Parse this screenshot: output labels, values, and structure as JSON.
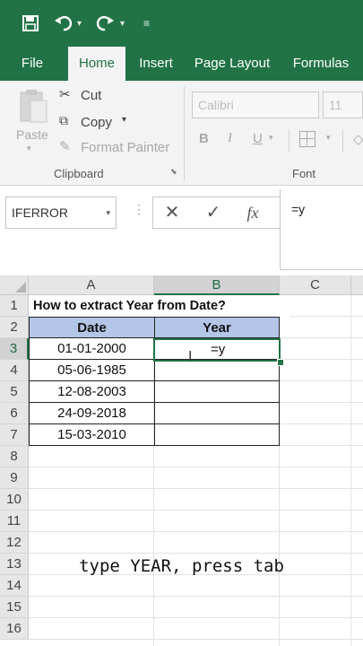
{
  "qat": {
    "save_icon": "save-icon",
    "undo_icon": "undo-icon",
    "redo_icon": "redo-icon",
    "customize_icon": "customize-qat-icon"
  },
  "tabs": [
    {
      "label": "File"
    },
    {
      "label": "Home"
    },
    {
      "label": "Insert"
    },
    {
      "label": "Page Layout"
    },
    {
      "label": "Formulas"
    }
  ],
  "ribbon": {
    "paste_label": "Paste",
    "cut_label": "Cut",
    "copy_label": "Copy",
    "format_painter_label": "Format Painter",
    "clipboard_group": "Clipboard",
    "font_name": "Calibri",
    "font_size": "11",
    "bold": "B",
    "italic": "I",
    "underline": "U",
    "font_group": "Font"
  },
  "formula_bar": {
    "name_box": "IFERROR",
    "cancel_symbol": "✕",
    "enter_symbol": "✓",
    "fx_symbol": "fx",
    "content": "=y"
  },
  "grid": {
    "columns": [
      "A",
      "B",
      "C"
    ],
    "selected_column": "B",
    "rows": [
      "1",
      "2",
      "3",
      "4",
      "5",
      "6",
      "7",
      "8",
      "9",
      "10",
      "11",
      "12",
      "13",
      "14",
      "15",
      "16"
    ],
    "selected_row": "3",
    "title": "How to extract Year from Date?",
    "header_date": "Date",
    "header_year": "Year",
    "dates": [
      "01-01-2000",
      "05-06-1985",
      "12-08-2003",
      "24-09-2018",
      "15-03-2010"
    ],
    "editing_text": "=y"
  },
  "caption": "type YEAR, press tab",
  "colors": {
    "excel_green": "#217346",
    "header_fill": "#b4c6e7"
  }
}
